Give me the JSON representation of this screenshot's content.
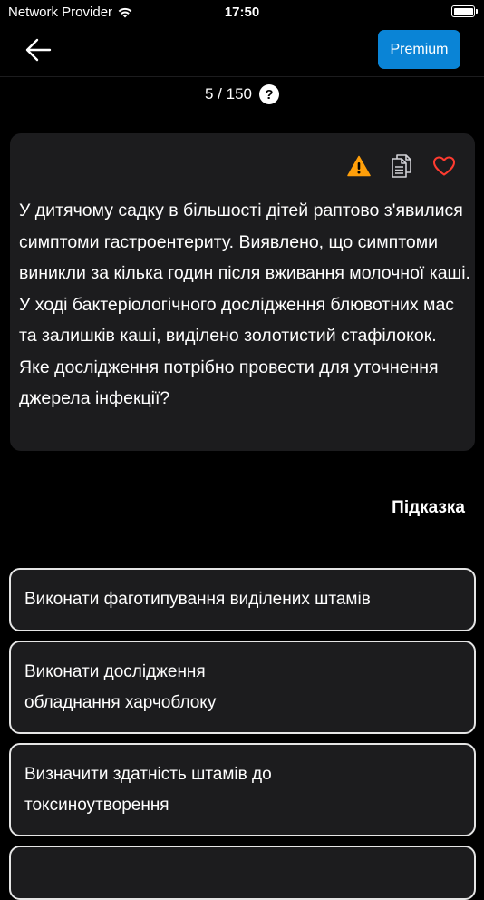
{
  "status_bar": {
    "carrier": "Network Provider",
    "time": "17:50",
    "battery_level": 1.0
  },
  "header": {
    "back_icon": "arrow-left-icon",
    "premium_label": "Premium",
    "premium_color": "#0a84d6"
  },
  "progress": {
    "text": "5 / 150",
    "help_label": "?"
  },
  "question": {
    "icons": [
      "warning-icon",
      "copy-icon",
      "heart-icon"
    ],
    "warning_color": "#ff9f0a",
    "heart_color": "#ff3b30",
    "text": "У дитячому садку в більшості дітей раптово з'явилися симптоми гастроентериту. Виявлено, що симптоми виникли за кілька годин після вживання молочної каші. У ході бактеріологічного дослідження блювотних мас та залишків каші, виділено золотистий стафілокок. Яке дослідження потрібно провести для уточнення джерела інфекції?"
  },
  "hint_label": "Підказка",
  "answers": [
    {
      "text": "Виконати фаготипування виділених штамів"
    },
    {
      "text": "Виконати дослідження\nобладнання харчоблоку"
    },
    {
      "text": "Визначити здатність штамів до токсиноутворення"
    },
    {
      "text": ""
    }
  ]
}
